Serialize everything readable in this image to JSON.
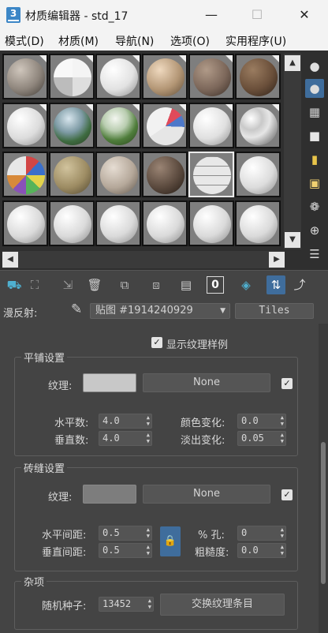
{
  "window": {
    "icon": "3",
    "title": "材质编辑器 - std_17",
    "minimize": "—",
    "maximize": "☐",
    "close": "✕"
  },
  "menu": [
    "模式(D)",
    "材质(M)",
    "导航(N)",
    "选项(O)",
    "实用程序(U)"
  ],
  "scroll": {
    "up": "▲",
    "down": "▼",
    "left": "◀",
    "right": "▶"
  },
  "diffuse_row": {
    "label": "漫反射:",
    "map_name": "贴图 #1914240929",
    "map_type": "Tiles"
  },
  "toolbar": {
    "digit_button": "0"
  },
  "show_texture_sample": "显示纹理样例",
  "tiling": {
    "title": "平铺设置",
    "texture_label": "纹理:",
    "texture_button": "None",
    "h_count_label": "水平数:",
    "h_count": "4.0",
    "v_count_label": "垂直数:",
    "v_count": "4.0",
    "color_var_label": "颜色变化:",
    "color_var": "0.0",
    "fade_var_label": "淡出变化:",
    "fade_var": "0.05"
  },
  "grout": {
    "title": "砖缝设置",
    "texture_label": "纹理:",
    "texture_button": "None",
    "h_gap_label": "水平间距:",
    "h_gap": "0.5",
    "v_gap_label": "垂直间距:",
    "v_gap": "0.5",
    "holes_label": "% 孔:",
    "holes": "0",
    "rough_label": "粗糙度:",
    "rough": "0.0"
  },
  "misc": {
    "title": "杂项",
    "seed_label": "随机种子:",
    "seed": "13452",
    "swap_button": "交换纹理条目"
  },
  "colors": {
    "tiles_swatch": "#c8c8c8",
    "grout_swatch": "#7d7d7d",
    "accent": "#3c86c6"
  }
}
